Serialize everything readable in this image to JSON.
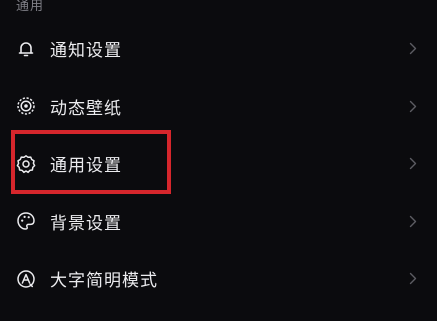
{
  "section": {
    "title": "通用"
  },
  "menu": {
    "items": [
      {
        "label": "通知设置",
        "icon": "bell-icon"
      },
      {
        "label": "动态壁纸",
        "icon": "live-wallpaper-icon"
      },
      {
        "label": "通用设置",
        "icon": "gear-icon"
      },
      {
        "label": "背景设置",
        "icon": "palette-icon"
      },
      {
        "label": "大字简明模式",
        "icon": "large-text-mode-icon"
      }
    ]
  },
  "highlight": {
    "color": "#d6262c",
    "target": "通用设置"
  },
  "colors": {
    "background": "#0b0b0e",
    "text": "#ececef",
    "muted": "#7f7f86",
    "chevron": "#5c5c63",
    "highlight": "#d6262c"
  }
}
